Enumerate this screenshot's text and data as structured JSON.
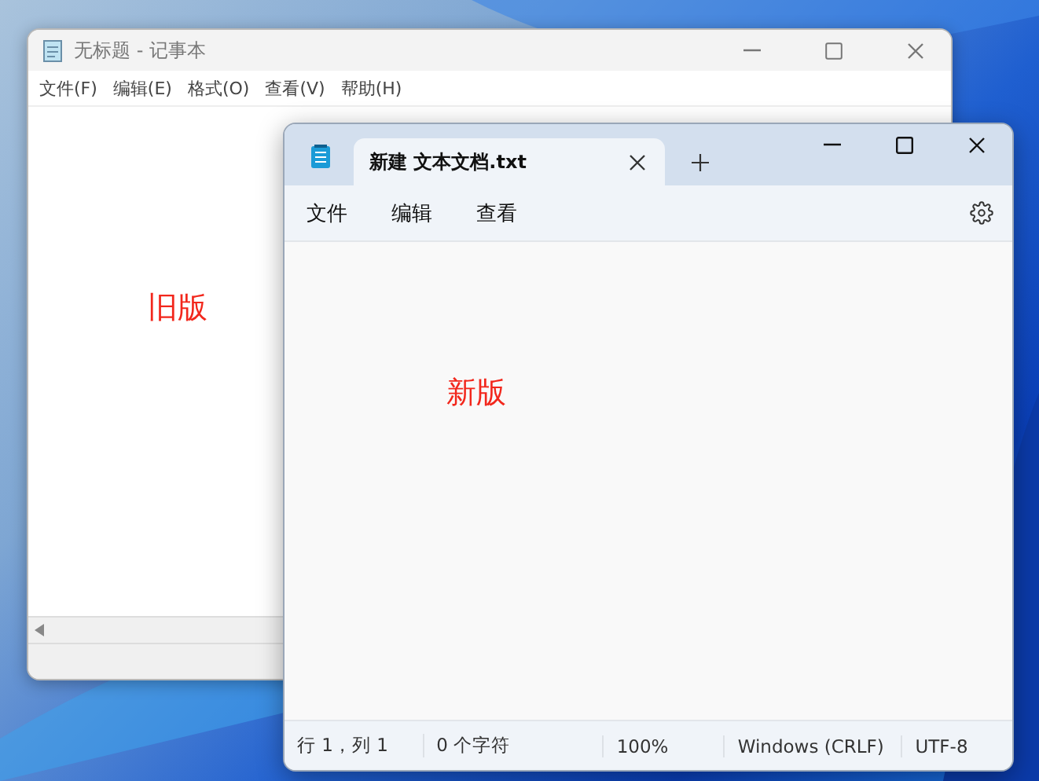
{
  "old_window": {
    "title": "无标题 - 记事本",
    "menu": [
      "文件(F)",
      "编辑(E)",
      "格式(O)",
      "查看(V)",
      "帮助(H)"
    ],
    "annotation": "旧版"
  },
  "new_window": {
    "tabs": [
      {
        "label": "新建 文本文档.txt",
        "selected": true
      }
    ],
    "menu": [
      "文件",
      "编辑",
      "查看"
    ],
    "annotation": "新版",
    "status_bar": [
      "行 1，列 1",
      "0 个字符",
      "100%",
      "Windows (CRLF)",
      "UTF-8"
    ]
  }
}
